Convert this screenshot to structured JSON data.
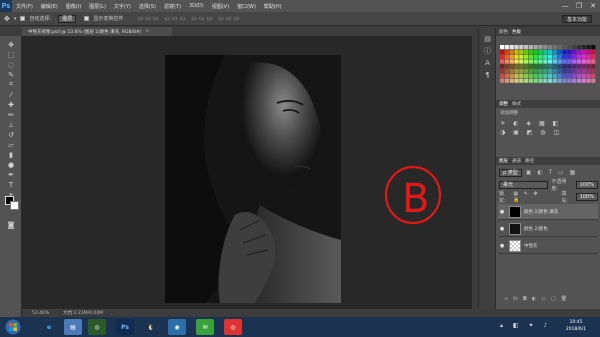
{
  "menubar": {
    "logo": "Ps",
    "items": [
      "文件(F)",
      "编辑(E)",
      "图像(I)",
      "图层(L)",
      "文字(Y)",
      "选择(S)",
      "滤镜(T)",
      "3D(D)",
      "视图(V)",
      "窗口(W)",
      "帮助(H)"
    ],
    "minimize": "—",
    "restore": "❐",
    "close": "✕"
  },
  "options": {
    "auto_select_label": "自动选择：",
    "auto_select_value": "图层",
    "show_transform_label": "显示变换控件",
    "workspace": "基本功能"
  },
  "document": {
    "tab_title": "中性灰修图.psd @ 53.6% (图层 2/颜色 填充, RGB/8#)",
    "tab_close": "×"
  },
  "status": {
    "zoom": "53.46%",
    "doc_size": "文档:2.21M/4.04M"
  },
  "panels": {
    "swatches_tabs": [
      "颜色",
      "色板"
    ],
    "adjust_tabs": [
      "调整",
      "样式"
    ],
    "adjust_label": "添加调整",
    "layers_tabs": [
      "图层",
      "通道",
      "路径"
    ],
    "kind_label": "ρ 类型",
    "blend_mode": "柔光",
    "opacity_label": "不透明度:",
    "opacity_value": "100%",
    "lock_label": "锁定:",
    "fill_label": "填充:",
    "fill_value": "100%",
    "layers": [
      {
        "name": "颜色 2/颜色 填充"
      },
      {
        "name": "颜色 2/颜色"
      },
      {
        "name": "中性灰"
      }
    ],
    "eye_glyph": "●"
  },
  "annotation": {
    "text": "B",
    "color": "#e01818"
  },
  "taskbar": {
    "time": "10:45",
    "date": "2018/6/1"
  },
  "colors": {
    "ps_dark": "#535353",
    "taskbar": "#1b3350",
    "annotation_red": "#e01818"
  }
}
